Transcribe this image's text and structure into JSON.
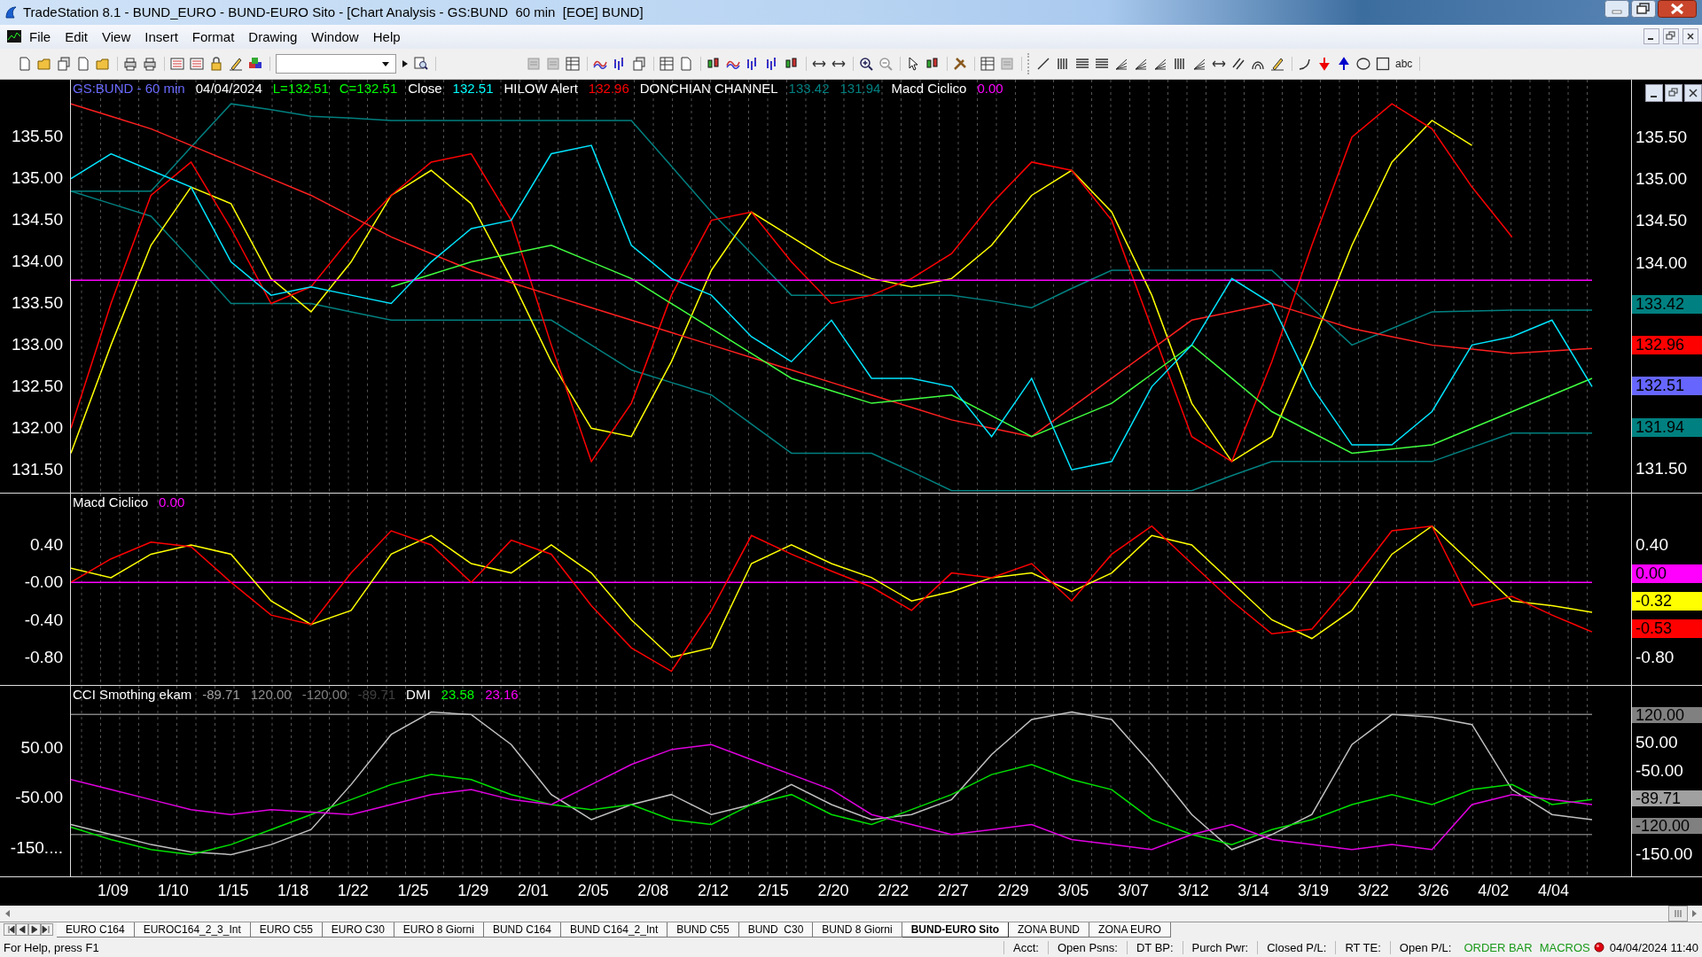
{
  "window": {
    "title": "TradeStation 8.1 - BUND_EURO - BUND-EURO Sito - [Chart Analysis - GS:BUND  60 min  [EOE] BUND]"
  },
  "menu": [
    "File",
    "Edit",
    "View",
    "Insert",
    "Format",
    "Drawing",
    "Window",
    "Help"
  ],
  "toolbar": {
    "text_tool": "abc"
  },
  "panels": [
    {
      "kind": "price",
      "legend": [
        {
          "text": "GS:BUND - 60 min",
          "color": "#6a6aff"
        },
        {
          "text": "04/04/2024",
          "color": "#ffffff"
        },
        {
          "text": "L=132.51",
          "color": "#00ff00"
        },
        {
          "text": "C=132.51",
          "color": "#00ff00"
        },
        {
          "text": "Close",
          "color": "#ffffff"
        },
        {
          "text": "132.51",
          "color": "#00ffff"
        },
        {
          "text": "HILOW Alert",
          "color": "#ffffff"
        },
        {
          "text": "132.96",
          "color": "#ff0000"
        },
        {
          "text": "DONCHIAN CHANNEL",
          "color": "#ffffff"
        },
        {
          "text": "133.42",
          "color": "#008080"
        },
        {
          "text": "131.94",
          "color": "#008080"
        },
        {
          "text": "Macd Ciclico",
          "color": "#ffffff"
        },
        {
          "text": "0.00",
          "color": "#ff00ff"
        }
      ],
      "chart_data": {
        "type": "line",
        "grid": true,
        "ylim": [
          131.22,
          136.19
        ],
        "yticks": [
          {
            "value": 135.5,
            "label": "135.50"
          },
          {
            "value": 135,
            "label": "135.00"
          },
          {
            "value": 134.5,
            "label": "134.50"
          },
          {
            "value": 134,
            "label": "134.00"
          },
          {
            "value": 133.5,
            "label": "133.50"
          },
          {
            "value": 133,
            "label": "133.00"
          },
          {
            "value": 132.5,
            "label": "132.50"
          },
          {
            "value": 132,
            "label": "132.00"
          },
          {
            "value": 131.5,
            "label": "131.50"
          }
        ],
        "series": [
          {
            "color": "#008080",
            "values": [
              134.85,
              134.85,
              134.85,
              135.38,
              135.9,
              135.83,
              135.75,
              135.73,
              135.7,
              135.7,
              135.7,
              135.7,
              135.7,
              135.7,
              135.7,
              135.15,
              134.6,
              134.1,
              133.6,
              133.6,
              133.6,
              133.6,
              133.6,
              133.53,
              133.45,
              133.68,
              133.9,
              133.9,
              133.9,
              133.9,
              133.9,
              133.45,
              133.0,
              133.2,
              133.4,
              133.41,
              133.42,
              133.42,
              133.42
            ]
          },
          {
            "color": "#008080",
            "values": [
              134.85,
              134.7,
              134.55,
              134.03,
              133.5,
              133.5,
              133.5,
              133.4,
              133.3,
              133.3,
              133.3,
              133.3,
              133.3,
              133.0,
              132.7,
              132.55,
              132.4,
              132.05,
              131.7,
              131.7,
              131.7,
              131.48,
              131.25,
              131.25,
              131.25,
              131.25,
              131.25,
              131.25,
              131.25,
              131.43,
              131.6,
              131.6,
              131.6,
              131.6,
              131.6,
              131.77,
              131.94,
              131.94,
              131.94
            ]
          },
          {
            "color": "#ffff00",
            "values": [
              131.7,
              133.0,
              134.2,
              134.9,
              134.7,
              133.8,
              133.4,
              134.0,
              134.8,
              135.1,
              134.7,
              133.8,
              132.8,
              132.0,
              131.9,
              132.8,
              133.9,
              134.6,
              134.3,
              134.0,
              133.8,
              133.7,
              133.8,
              134.2,
              134.8,
              135.1,
              134.6,
              133.6,
              132.3,
              131.6,
              131.9,
              133.0,
              134.2,
              135.2,
              135.7,
              135.4,
              null,
              null,
              null
            ]
          },
          {
            "color": "#ff0000",
            "values": [
              132.0,
              133.5,
              134.8,
              135.2,
              134.4,
              133.5,
              133.7,
              134.3,
              134.8,
              135.2,
              135.3,
              134.5,
              133.0,
              131.6,
              132.3,
              133.6,
              134.5,
              134.6,
              134.0,
              133.5,
              133.6,
              133.8,
              134.1,
              134.7,
              135.2,
              135.1,
              134.5,
              133.2,
              131.9,
              131.6,
              132.8,
              134.2,
              135.5,
              135.9,
              135.6,
              134.9,
              134.3,
              null,
              null
            ]
          },
          {
            "color": "#ff2020",
            "values": [
              135.9,
              135.75,
              135.6,
              135.4,
              135.2,
              135.0,
              134.8,
              134.55,
              134.3,
              134.1,
              133.9,
              133.75,
              133.6,
              133.45,
              133.3,
              133.15,
              133.0,
              132.85,
              132.7,
              132.55,
              132.4,
              132.25,
              132.1,
              132.0,
              131.9,
              132.25,
              132.6,
              132.95,
              133.3,
              133.4,
              133.5,
              133.35,
              133.2,
              133.1,
              133.0,
              132.95,
              132.9,
              132.93,
              132.96
            ]
          },
          {
            "color": "#40ff40",
            "values": [
              null,
              null,
              null,
              null,
              null,
              null,
              null,
              null,
              133.7,
              133.85,
              134.0,
              134.1,
              134.2,
              134.0,
              133.8,
              133.5,
              133.2,
              132.9,
              132.6,
              132.45,
              132.3,
              132.35,
              132.4,
              132.15,
              131.9,
              132.1,
              132.3,
              132.65,
              133.0,
              132.6,
              132.2,
              131.95,
              131.7,
              131.75,
              131.8,
              132.0,
              132.2,
              132.4,
              132.6
            ]
          },
          {
            "color": "#ff00ff",
            "values": [
              133.78,
              133.78,
              133.78,
              133.78,
              133.78,
              133.78,
              133.78,
              133.78,
              133.78,
              133.78,
              133.78,
              133.78,
              133.78,
              133.78,
              133.78,
              133.78,
              133.78,
              133.78,
              133.78,
              133.78,
              133.78,
              133.78,
              133.78,
              133.78,
              133.78,
              133.78,
              133.78,
              133.78,
              133.78,
              133.78,
              133.78,
              133.78,
              133.78,
              133.78,
              133.78,
              133.78,
              133.78,
              133.78,
              133.78
            ]
          },
          {
            "color": "#00e5ff",
            "values": [
              135.0,
              135.3,
              135.1,
              134.9,
              134.0,
              133.6,
              133.7,
              133.6,
              133.5,
              134.0,
              134.4,
              134.5,
              135.3,
              135.4,
              134.2,
              133.8,
              133.6,
              133.1,
              132.8,
              133.3,
              132.6,
              132.6,
              132.5,
              131.9,
              132.6,
              131.5,
              131.6,
              132.5,
              133.0,
              133.8,
              133.5,
              132.5,
              131.8,
              131.8,
              132.2,
              133.0,
              133.1,
              133.3,
              132.5
            ]
          }
        ]
      },
      "right_axis": [
        {
          "kind": "tick",
          "text": "135.50"
        },
        {
          "kind": "tick",
          "text": "135.00"
        },
        {
          "kind": "tick",
          "text": "134.50"
        },
        {
          "kind": "tick",
          "text": "134.00"
        },
        {
          "kind": "badge",
          "text": "133.42",
          "color": "#008080"
        },
        {
          "kind": "badge",
          "text": "132.96",
          "color": "#ff0000"
        },
        {
          "kind": "badge",
          "text": "132.51",
          "color": "#6666ff"
        },
        {
          "kind": "badge",
          "text": "131.94",
          "color": "#008080"
        },
        {
          "kind": "tick",
          "text": "131.50"
        }
      ]
    },
    {
      "kind": "macd",
      "legend": [
        {
          "text": "Macd Ciclico",
          "color": "#ffffff"
        },
        {
          "text": "0.00",
          "color": "#ff00ff"
        }
      ],
      "chart_data": {
        "type": "line",
        "grid": true,
        "ylim": [
          -1.094,
          0.948
        ],
        "yticks": [
          {
            "value": 0.4,
            "label": "0.40"
          },
          {
            "value": 0,
            "label": "-0.00"
          },
          {
            "value": -0.4,
            "label": "-0.40"
          },
          {
            "value": -0.8,
            "label": "-0.80"
          }
        ],
        "series": [
          {
            "color": "#ff00ff",
            "values": [
              0,
              0,
              0,
              0,
              0,
              0,
              0,
              0,
              0,
              0,
              0,
              0,
              0,
              0,
              0,
              0,
              0,
              0,
              0,
              0,
              0,
              0,
              0,
              0,
              0,
              0,
              0,
              0,
              0,
              0,
              0,
              0,
              0,
              0,
              0,
              0,
              0,
              0,
              0
            ]
          },
          {
            "color": "#ffff00",
            "values": [
              0.15,
              0.05,
              0.3,
              0.4,
              0.3,
              -0.2,
              -0.45,
              -0.3,
              0.3,
              0.5,
              0.2,
              0.1,
              0.4,
              0.1,
              -0.4,
              -0.8,
              -0.7,
              0.2,
              0.4,
              0.2,
              0.05,
              -0.2,
              -0.1,
              0.05,
              0.1,
              -0.1,
              0.1,
              0.5,
              0.4,
              0.0,
              -0.4,
              -0.6,
              -0.3,
              0.3,
              0.6,
              0.2,
              -0.2,
              -0.25,
              -0.32
            ]
          },
          {
            "color": "#ff0000",
            "values": [
              0.0,
              0.25,
              0.43,
              0.38,
              0.0,
              -0.35,
              -0.45,
              0.1,
              0.55,
              0.4,
              0.0,
              0.45,
              0.3,
              -0.25,
              -0.7,
              -0.95,
              -0.3,
              0.5,
              0.3,
              0.12,
              -0.05,
              -0.3,
              0.1,
              0.05,
              0.2,
              -0.2,
              0.3,
              0.6,
              0.2,
              -0.2,
              -0.55,
              -0.5,
              0.0,
              0.55,
              0.6,
              -0.25,
              -0.15,
              -0.35,
              -0.53
            ]
          }
        ]
      },
      "right_axis": [
        {
          "kind": "tick",
          "text": "0.40"
        },
        {
          "kind": "badge",
          "text": "0.00",
          "color": "#ff00ff"
        },
        {
          "kind": "badge",
          "text": "-0.32",
          "color": "#ffff00"
        },
        {
          "kind": "badge",
          "text": "-0.53",
          "color": "#ff0000"
        },
        {
          "kind": "tick",
          "text": "-0.80"
        }
      ]
    },
    {
      "kind": "cci",
      "legend": [
        {
          "text": "CCI Smothing ekam",
          "color": "#ffffff"
        },
        {
          "text": "-89.71",
          "color": "#a0a0a0"
        },
        {
          "text": "120.00",
          "color": "#909090"
        },
        {
          "text": "-120.00",
          "color": "#808080"
        },
        {
          "text": "-89.71",
          "color": "#404040"
        },
        {
          "text": "DMI",
          "color": "#ffffff"
        },
        {
          "text": "23.58",
          "color": "#00ff00"
        },
        {
          "text": "23.16",
          "color": "#ff00ff"
        }
      ],
      "chart_data": {
        "type": "line",
        "grid": true,
        "ylim": [
          -203.1,
          177.4
        ],
        "yticks": [
          {
            "value": 50,
            "label": "50.00"
          },
          {
            "value": -50,
            "label": "-50.00"
          },
          {
            "value": -150,
            "label": "-150...."
          }
        ],
        "series": [
          {
            "color": "#808080",
            "values": [
              120,
              120,
              120,
              120,
              120,
              120,
              120,
              120,
              120,
              120,
              120,
              120,
              120,
              120,
              120,
              120,
              120,
              120,
              120,
              120,
              120,
              120,
              120,
              120,
              120,
              120,
              120,
              120,
              120,
              120,
              120,
              120,
              120,
              120,
              120,
              120,
              120,
              120,
              120
            ]
          },
          {
            "color": "#707070",
            "values": [
              -120,
              -120,
              -120,
              -120,
              -120,
              -120,
              -120,
              -120,
              -120,
              -120,
              -120,
              -120,
              -120,
              -120,
              -120,
              -120,
              -120,
              -120,
              -120,
              -120,
              -120,
              -120,
              -120,
              -120,
              -120,
              -120,
              -120,
              -120,
              -120,
              -120,
              -120,
              -120,
              -120,
              -120,
              -120,
              -120,
              -120,
              -120,
              -120
            ]
          },
          {
            "color": "#c0c0c0",
            "values": [
              -100,
              -120,
              -140,
              -155,
              -160,
              -140,
              -110,
              -20,
              80,
              125,
              120,
              60,
              -40,
              -90,
              -60,
              -40,
              -80,
              -60,
              -20,
              -60,
              -90,
              -80,
              -50,
              40,
              110,
              125,
              110,
              20,
              -80,
              -150,
              -120,
              -80,
              60,
              120,
              115,
              100,
              -30,
              -80,
              -90
            ]
          },
          {
            "color": "#00e000",
            "values": [
              -105,
              -130,
              -150,
              -160,
              -140,
              -110,
              -80,
              -50,
              -20,
              0,
              -10,
              -40,
              -60,
              -70,
              -60,
              -90,
              -100,
              -60,
              -40,
              -80,
              -100,
              -70,
              -40,
              0,
              20,
              -10,
              -30,
              -90,
              -120,
              -140,
              -110,
              -90,
              -60,
              -40,
              -60,
              -30,
              -20,
              -60,
              -50
            ]
          },
          {
            "color": "#e000e0",
            "values": [
              -10,
              -30,
              -50,
              -70,
              -80,
              -70,
              -75,
              -80,
              -60,
              -40,
              -30,
              -50,
              -60,
              -20,
              20,
              50,
              60,
              30,
              0,
              -30,
              -80,
              -100,
              -120,
              -110,
              -100,
              -130,
              -140,
              -150,
              -120,
              -100,
              -130,
              -140,
              -150,
              -140,
              -150,
              -60,
              -40,
              -50,
              -60
            ]
          }
        ]
      },
      "right_axis": [
        {
          "kind": "badge",
          "text": "120.00",
          "color": "#808080"
        },
        {
          "kind": "tick",
          "text": "50.00"
        },
        {
          "kind": "tick",
          "text": "-50.00"
        },
        {
          "kind": "badge",
          "text": "-89.71",
          "color": "#a0a0a0"
        },
        {
          "kind": "badge",
          "text": "-120.00",
          "color": "#808080"
        },
        {
          "kind": "tick",
          "text": "-150.00"
        }
      ]
    }
  ],
  "dates": [
    "1/09",
    "1/10",
    "1/15",
    "1/18",
    "1/22",
    "1/25",
    "1/29",
    "2/01",
    "2/05",
    "2/08",
    "2/12",
    "2/15",
    "2/20",
    "2/22",
    "2/27",
    "2/29",
    "3/05",
    "3/07",
    "3/12",
    "3/14",
    "3/19",
    "3/22",
    "3/26",
    "4/02",
    "4/04"
  ],
  "sheet_tabs": [
    {
      "label": "EURO C164",
      "selected": false
    },
    {
      "label": "EUROC164_2_3_Int",
      "selected": false
    },
    {
      "label": "EURO C55",
      "selected": false
    },
    {
      "label": "EURO C30",
      "selected": false
    },
    {
      "label": "EURO 8 Giorni",
      "selected": false
    },
    {
      "label": "BUND C164",
      "selected": false
    },
    {
      "label": "BUND C164_2_Int",
      "selected": false
    },
    {
      "label": "BUND C55",
      "selected": false
    },
    {
      "label": "BUND  C30",
      "selected": false
    },
    {
      "label": "BUND 8 Giorni",
      "selected": false
    },
    {
      "label": "BUND-EURO Sito",
      "selected": true
    },
    {
      "label": "ZONA BUND",
      "selected": false
    },
    {
      "label": "ZONA EURO",
      "selected": false
    }
  ],
  "status_bar": {
    "help": "For Help, press F1",
    "fields": [
      "Acct:",
      "Open Psns:",
      "DT BP:",
      "Purch Pwr:",
      "Closed P/L:",
      "RT TE:",
      "Open P/L:"
    ],
    "indicators": [
      "ORDER BAR",
      "MACROS"
    ],
    "datetime": "04/04/2024 11:40"
  }
}
